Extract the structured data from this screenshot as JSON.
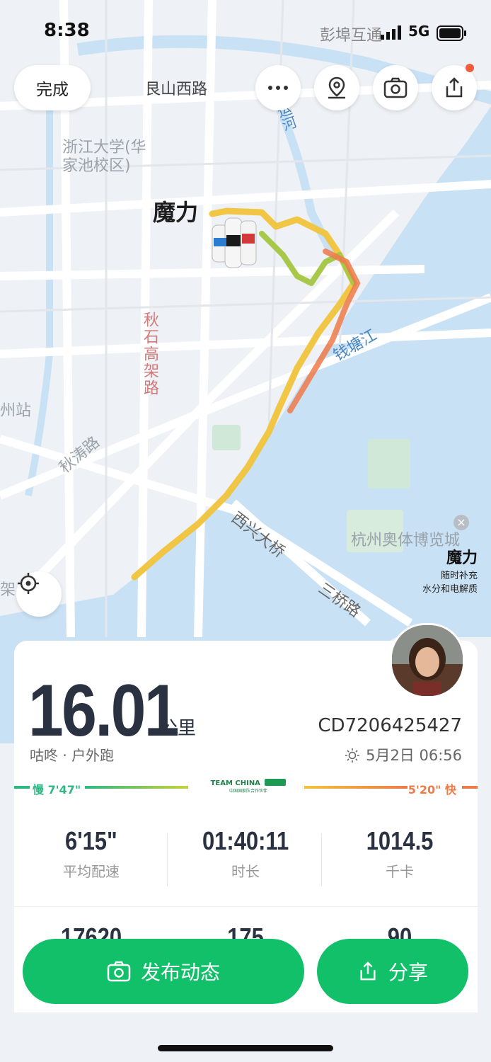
{
  "status": {
    "time": "8:38",
    "carrier": "彭埠互通",
    "network": "5G"
  },
  "top_bar": {
    "done_label": "完成"
  },
  "map": {
    "labels": {
      "road_genshan": "艮山西路",
      "river_canal": "运河",
      "zju": "浙江大学(华家池校区)",
      "qiushi": "秋石高架路",
      "station": "州站",
      "qiutao": "秋涛路",
      "qiantang": "钱塘江",
      "xixing": "西兴大桥",
      "sanqiao": "三桥路",
      "expo": "杭州奥体博览城",
      "jia": "架"
    },
    "brand_marker": "魔力",
    "ad": {
      "brand": "魔力",
      "line1": "随时补充",
      "line2": "水分和电解质"
    }
  },
  "summary": {
    "distance": "16.01",
    "unit": "公里",
    "subtitle": "咕咚 · 户外跑",
    "record_code": "CD7206425427",
    "date": "5月2日 06:56"
  },
  "pace_scale": {
    "slow": "慢 7'47\"",
    "fast": "5'20\" 快",
    "team": "TEAM CHINA",
    "team_sub": "中国国家队合作伙伴"
  },
  "stats": [
    {
      "value": "6'15\"",
      "label": "平均配速"
    },
    {
      "value": "01:40:11",
      "label": "时长"
    },
    {
      "value": "1014.5",
      "label": "千卡"
    }
  ],
  "stats2": [
    {
      "value": "17620"
    },
    {
      "value": "175"
    },
    {
      "value": "90"
    }
  ],
  "actions": {
    "post": "发布动态",
    "share": "分享"
  },
  "colors": {
    "accent": "#12c06a",
    "route_slow": "#f2d23a",
    "route_fast": "#ee7a4a",
    "water": "#c9e1f5"
  }
}
